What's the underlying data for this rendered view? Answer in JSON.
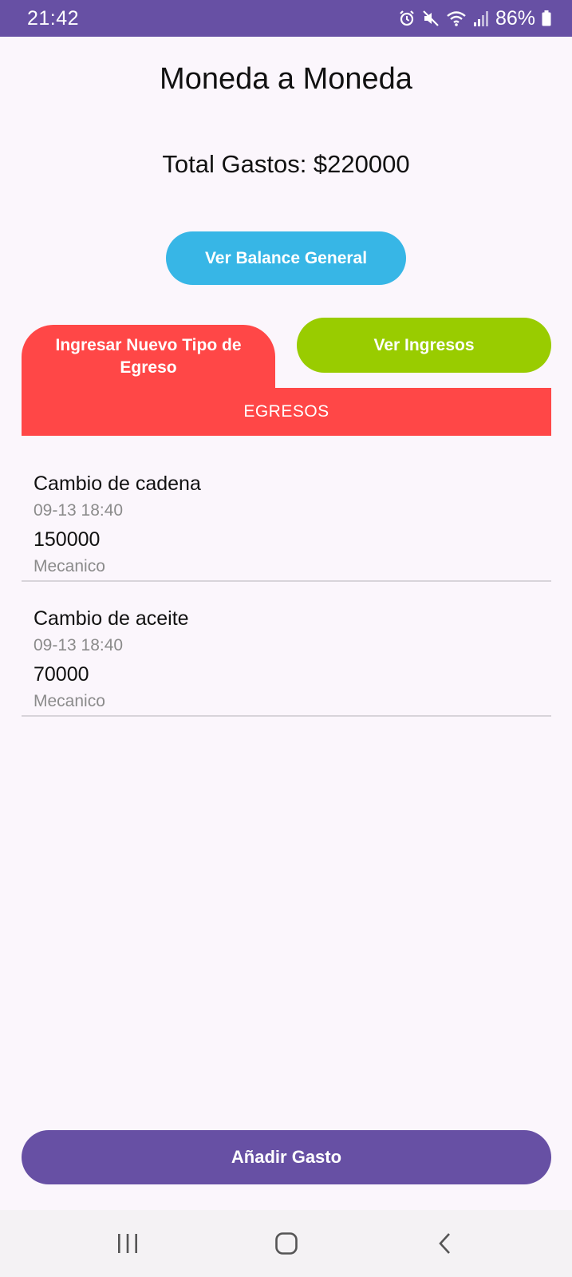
{
  "status_bar": {
    "time": "21:42",
    "battery": "86%",
    "icons": [
      "alarm-icon",
      "mute-icon",
      "wifi-icon",
      "signal-icon",
      "battery-icon"
    ]
  },
  "header": {
    "title": "Moneda a Moneda",
    "total": "Total Gastos: $220000"
  },
  "buttons": {
    "balance": "Ver Balance General",
    "new_type": "Ingresar Nuevo Tipo de Egreso",
    "income": "Ver Ingresos",
    "add": "Añadir Gasto"
  },
  "section": {
    "title": "EGRESOS"
  },
  "expenses": [
    {
      "name": "Cambio de cadena",
      "date": "09-13 18:40",
      "amount": "150000",
      "category": "Mecanico"
    },
    {
      "name": "Cambio de aceite",
      "date": "09-13 18:40",
      "amount": "70000",
      "category": "Mecanico"
    }
  ],
  "nav": {
    "icons": [
      "recent-apps-icon",
      "home-icon",
      "back-icon"
    ]
  },
  "colors": {
    "primary": "#6750a4",
    "balance_button": "#37b6e6",
    "expense_red": "#ff4747",
    "income_green": "#99cc00",
    "background": "#fbf6fc"
  }
}
